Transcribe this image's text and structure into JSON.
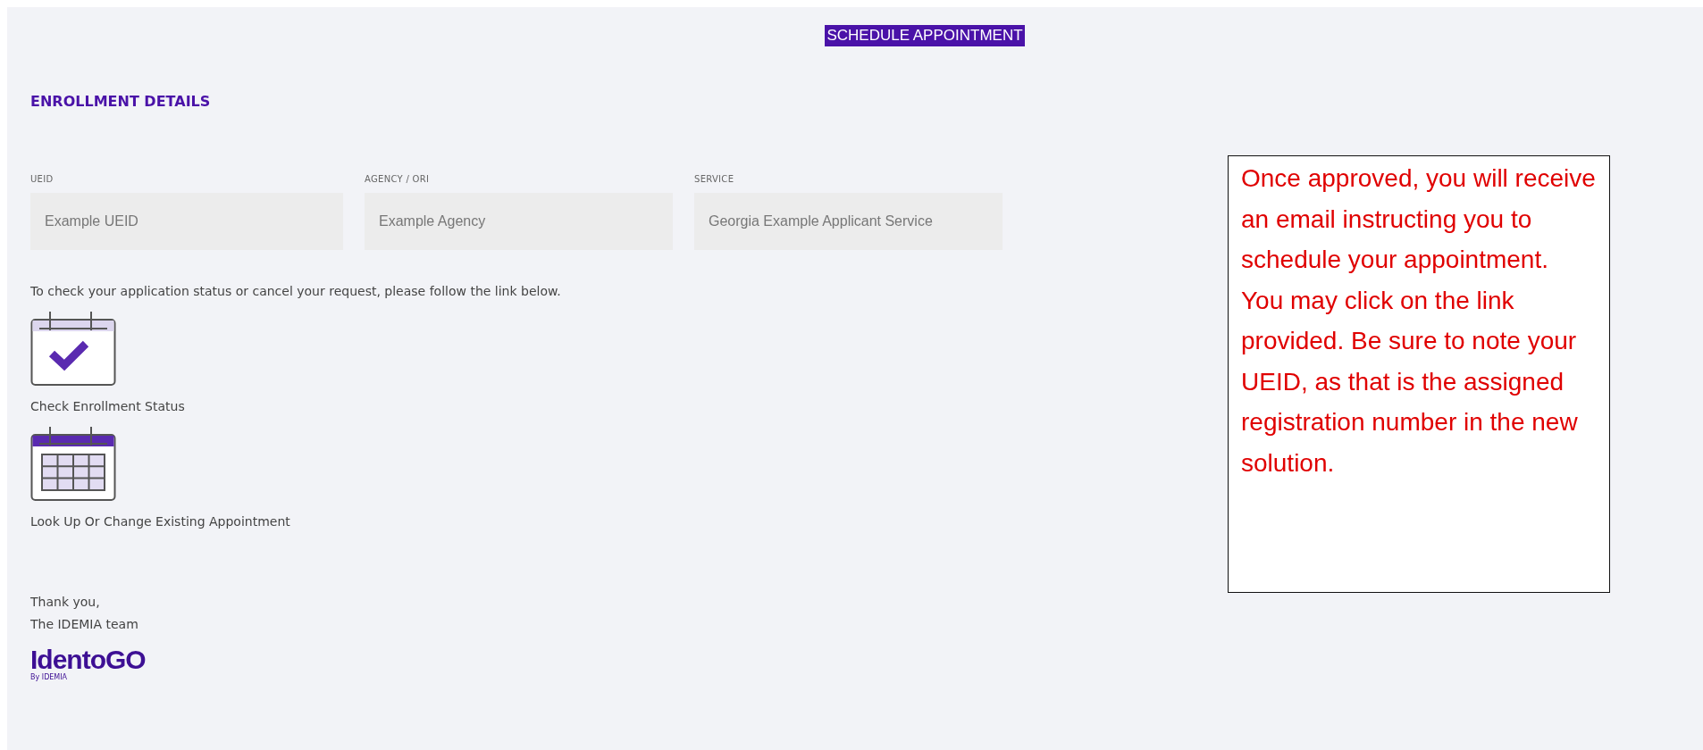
{
  "header": {
    "title": "SCHEDULE APPOINTMENT"
  },
  "section": {
    "title": "ENROLLMENT DETAILS"
  },
  "fields": [
    {
      "label": "UEID",
      "value": "Example UEID"
    },
    {
      "label": "AGENCY / ORI",
      "value": "Example Agency"
    },
    {
      "label": "SERVICE",
      "value": "Georgia Example Applicant Service"
    }
  ],
  "instructions": "To check your application status or cancel your request, please follow the link below.",
  "links": [
    {
      "kind": "check",
      "label": "Check Enrollment Status"
    },
    {
      "kind": "calendar",
      "label": "Look Up Or Change Existing Appointment"
    }
  ],
  "signoff": [
    "Thank you,",
    "The IDEMIA team"
  ],
  "logo": {
    "name": "IdentoGO",
    "tagline": "By IDEMIA"
  },
  "note": "Once approved, you will receive an email instructing you to schedule your appointment. You may click on the link provided. Be sure to note your UEID, as that is the assigned registration number in the new solution."
}
